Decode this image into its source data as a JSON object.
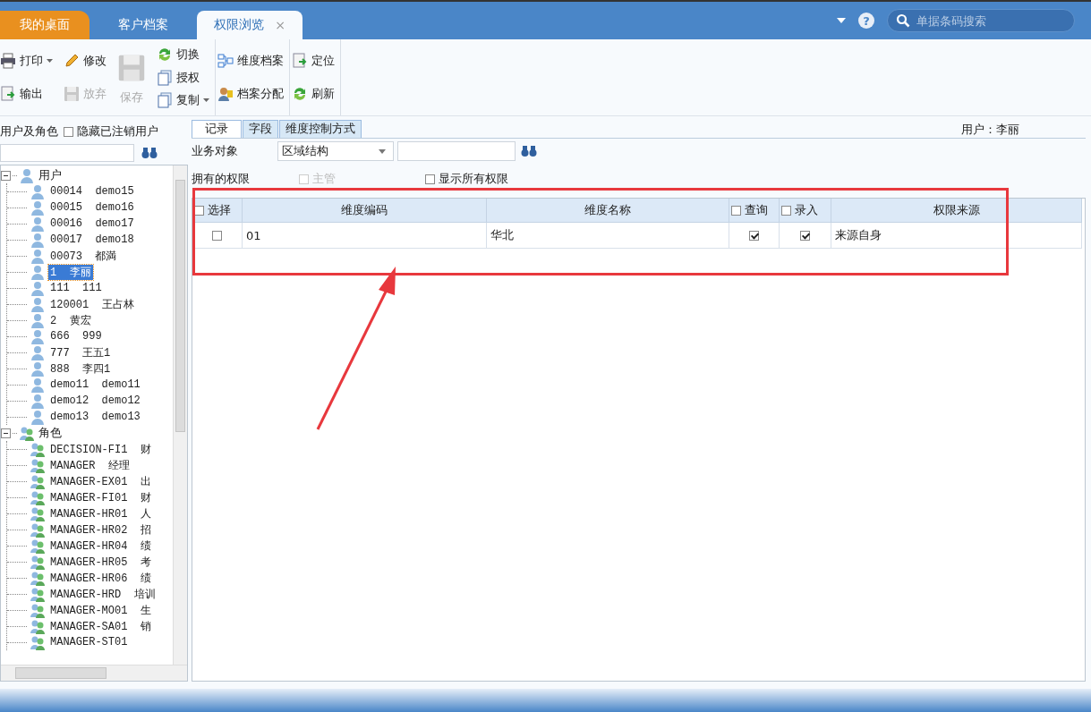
{
  "tabs": [
    {
      "label": "我的桌面",
      "kind": "home",
      "selected": false
    },
    {
      "label": "客户档案",
      "kind": "normal",
      "selected": false
    },
    {
      "label": "权限浏览",
      "kind": "normal",
      "selected": true,
      "close": "×"
    }
  ],
  "help": "?",
  "header_search": {
    "placeholder": "单据条码搜索"
  },
  "toolbar": [
    {
      "columns": [
        [
          {
            "label": "打印",
            "kind": "small",
            "disabled": false,
            "dropdown": true
          },
          {
            "label": "输出",
            "kind": "small",
            "disabled": false,
            "dropdown": false
          }
        ],
        [
          {
            "label": "修改",
            "kind": "small",
            "disabled": false,
            "dropdown": false
          },
          {
            "label": "放弃",
            "kind": "small",
            "disabled": true,
            "dropdown": false
          }
        ],
        [
          {
            "label": "保存",
            "kind": "large",
            "disabled": true,
            "dropdown": false
          }
        ],
        [
          {
            "label": "切换",
            "kind": "small",
            "disabled": false,
            "dropdown": false
          },
          {
            "label": "授权",
            "kind": "small",
            "disabled": false,
            "dropdown": false
          },
          {
            "label": "复制",
            "kind": "small",
            "disabled": false,
            "dropdown": true
          }
        ]
      ]
    },
    {
      "columns": [
        [
          {
            "label": "维度档案",
            "kind": "small",
            "disabled": false,
            "dropdown": false
          },
          {
            "label": "档案分配",
            "kind": "small",
            "disabled": false,
            "dropdown": false
          }
        ]
      ]
    },
    {
      "columns": [
        [
          {
            "label": "定位",
            "kind": "small",
            "disabled": false,
            "dropdown": false
          },
          {
            "label": "刷新",
            "kind": "small",
            "disabled": false,
            "dropdown": false
          }
        ]
      ]
    }
  ],
  "left_panel": {
    "title": "用户及角色",
    "hide_cancelled": {
      "label": "隐藏已注销用户",
      "checked": false
    },
    "tree": [
      {
        "label": "用户",
        "kind": "user",
        "expanded": true,
        "children": [
          {
            "label": "00014  demo15",
            "selected": false
          },
          {
            "label": "00015  demo16",
            "selected": false
          },
          {
            "label": "00016  demo17",
            "selected": false
          },
          {
            "label": "00017  demo18",
            "selected": false
          },
          {
            "label": "00073  都満",
            "selected": false
          },
          {
            "label": "1  李丽",
            "selected": true
          },
          {
            "label": "111  111",
            "selected": false
          },
          {
            "label": "120001  王占林",
            "selected": false
          },
          {
            "label": "2  黄宏",
            "selected": false
          },
          {
            "label": "666  999",
            "selected": false
          },
          {
            "label": "777  王五1",
            "selected": false
          },
          {
            "label": "888  李四1",
            "selected": false
          },
          {
            "label": "demo11  demo11",
            "selected": false
          },
          {
            "label": "demo12  demo12",
            "selected": false
          },
          {
            "label": "demo13  demo13",
            "selected": false
          }
        ]
      },
      {
        "label": "角色",
        "kind": "role",
        "expanded": true,
        "children": [
          {
            "label": "DECISION-FI1  财",
            "selected": false
          },
          {
            "label": "MANAGER  经理",
            "selected": false
          },
          {
            "label": "MANAGER-EX01  出",
            "selected": false
          },
          {
            "label": "MANAGER-FI01  财",
            "selected": false
          },
          {
            "label": "MANAGER-HR01  人",
            "selected": false
          },
          {
            "label": "MANAGER-HR02  招",
            "selected": false
          },
          {
            "label": "MANAGER-HR04  绩",
            "selected": false
          },
          {
            "label": "MANAGER-HR05  考",
            "selected": false
          },
          {
            "label": "MANAGER-HR06  绩",
            "selected": false
          },
          {
            "label": "MANAGER-HRD  培训",
            "selected": false
          },
          {
            "label": "MANAGER-MO01  生",
            "selected": false
          },
          {
            "label": "MANAGER-SA01  销",
            "selected": false
          },
          {
            "label": "MANAGER-ST01",
            "selected": false
          }
        ]
      }
    ]
  },
  "right_panel": {
    "tabs": [
      {
        "label": "记录",
        "selected": true
      },
      {
        "label": "字段",
        "selected": false
      },
      {
        "label": "维度控制方式",
        "selected": false
      }
    ],
    "user_label": "用户：李丽",
    "object_label": "业务对象",
    "object_select": {
      "value": "区域结构"
    },
    "owned_label": "拥有的权限",
    "options": [
      {
        "label": "主管",
        "checked": false,
        "disabled": true
      },
      {
        "label": "显示所有权限",
        "checked": false,
        "disabled": false
      }
    ],
    "grid": {
      "columns": [
        {
          "label": "选择",
          "checkbox": true,
          "checked": false
        },
        {
          "label": "维度编码"
        },
        {
          "label": "维度名称"
        },
        {
          "label": "查询",
          "checkbox": true,
          "checked": false
        },
        {
          "label": "录入",
          "checkbox": true,
          "checked": false
        },
        {
          "label": "权限来源"
        }
      ],
      "rows": [
        {
          "selected": false,
          "code": "01",
          "name": "华北",
          "query": true,
          "entry": true,
          "source": "来源自身"
        }
      ]
    }
  },
  "annotations": {
    "highlight_box": true,
    "arrow": true
  }
}
